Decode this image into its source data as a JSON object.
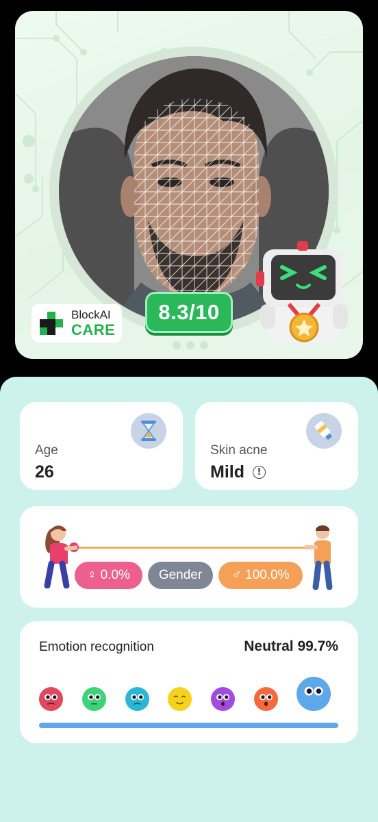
{
  "photo": {
    "score": "8.3/10",
    "logo": {
      "line1": "BlockAI",
      "line2": "CARE"
    },
    "icons": [
      "face-mesh-photo",
      "robot-mascot-with-medal"
    ]
  },
  "stats": {
    "age": {
      "label": "Age",
      "value": "26",
      "icon": "hourglass-icon"
    },
    "acne": {
      "label": "Skin acne",
      "value": "Mild",
      "icon": "cream-tube-icon",
      "info_glyph": "!"
    }
  },
  "gender": {
    "female": "♀ 0.0%",
    "label": "Gender",
    "male": "♂ 100.0%"
  },
  "emotion": {
    "title": "Emotion recognition",
    "result": "Neutral 99.7%",
    "emotions": [
      {
        "name": "angry",
        "color": "#e0485c"
      },
      {
        "name": "disgust",
        "color": "#3ed37a"
      },
      {
        "name": "sad",
        "color": "#2bb7d4"
      },
      {
        "name": "happy",
        "color": "#f7d21d"
      },
      {
        "name": "fear",
        "color": "#a24be0"
      },
      {
        "name": "surprise",
        "color": "#f46a3c"
      },
      {
        "name": "neutral",
        "color": "#5ea8ea",
        "selected": true
      }
    ],
    "bar_color": "#5ea8ea"
  }
}
